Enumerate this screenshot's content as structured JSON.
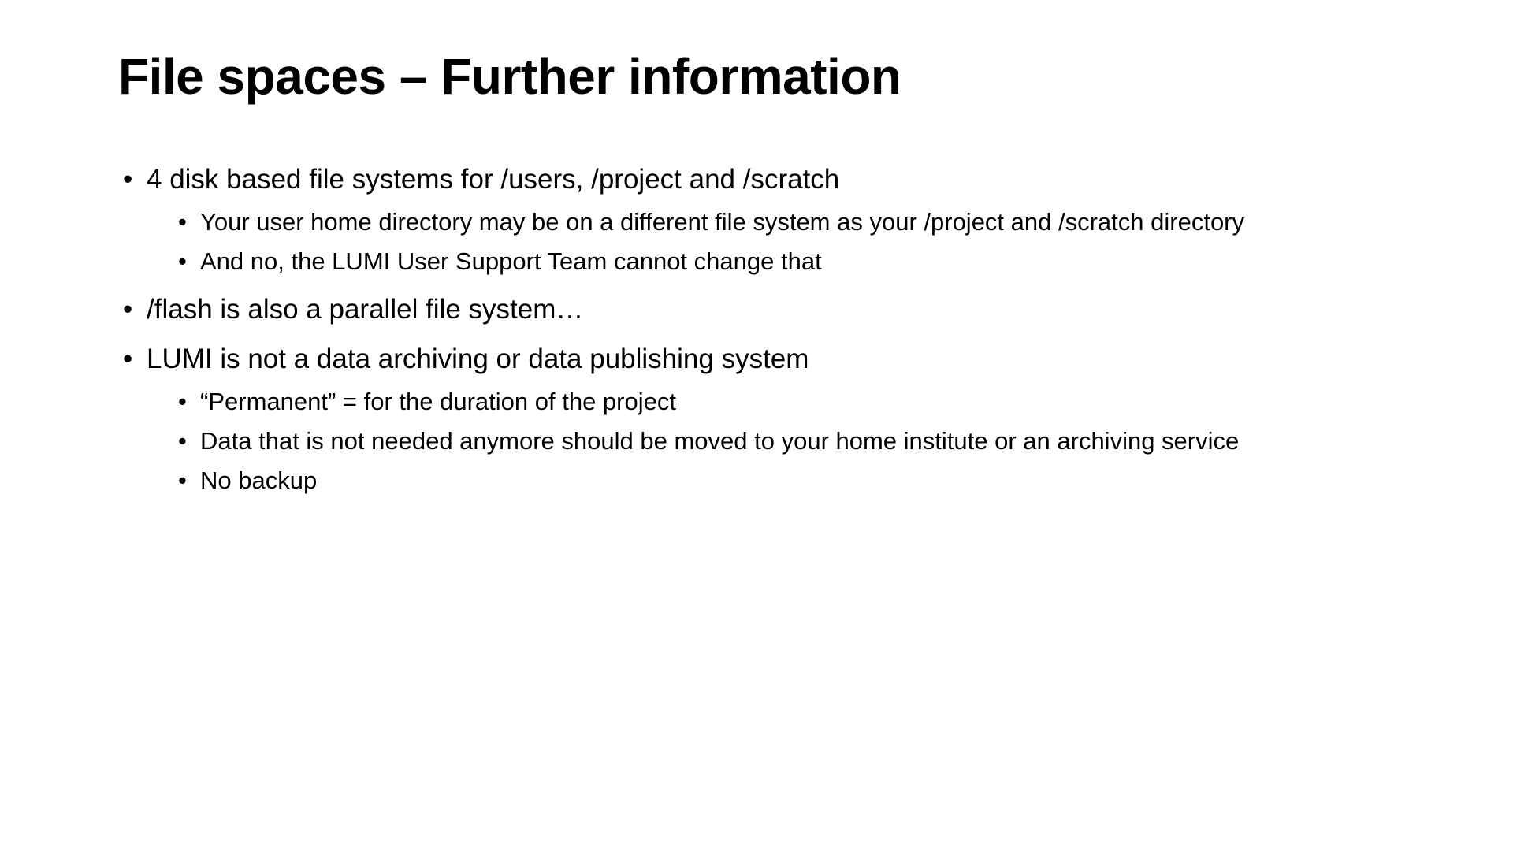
{
  "title": "File spaces – Further information",
  "bullets": {
    "b0": {
      "text": "4 disk based file systems for /users, /project and /scratch",
      "sub": {
        "s0": "Your user home directory may be on a different file system as your /project and /scratch directory",
        "s1": "And no, the LUMI User Support Team cannot change that"
      }
    },
    "b1": {
      "text": "/flash is also a parallel file system…"
    },
    "b2": {
      "text": "LUMI is not a data archiving or data publishing system",
      "sub": {
        "s0": "“Permanent” = for the duration of the project",
        "s1": "Data that is not needed anymore should be moved to your home institute or an archiving service",
        "s2": "No backup"
      }
    }
  }
}
